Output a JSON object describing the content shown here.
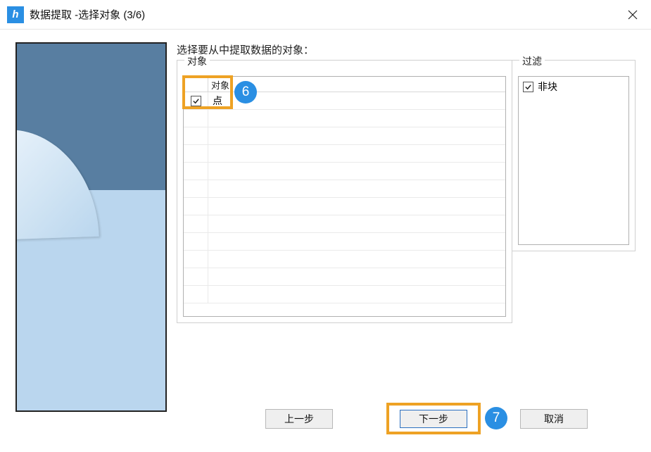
{
  "titlebar": {
    "title": "数据提取 -选择对象 (3/6)"
  },
  "instruction": "选择要从中提取数据的对象：",
  "groups": {
    "objects_legend": "对象",
    "objects_column_header": "对象",
    "objects_rows": [
      {
        "label": "点",
        "checked": true
      }
    ],
    "filter_legend": "过滤",
    "filter_items": [
      {
        "label": "非块",
        "checked": true
      }
    ]
  },
  "buttons": {
    "prev": "上一步",
    "next": "下一步",
    "cancel": "取消"
  },
  "annotations": {
    "badge6": "6",
    "badge7": "7"
  }
}
